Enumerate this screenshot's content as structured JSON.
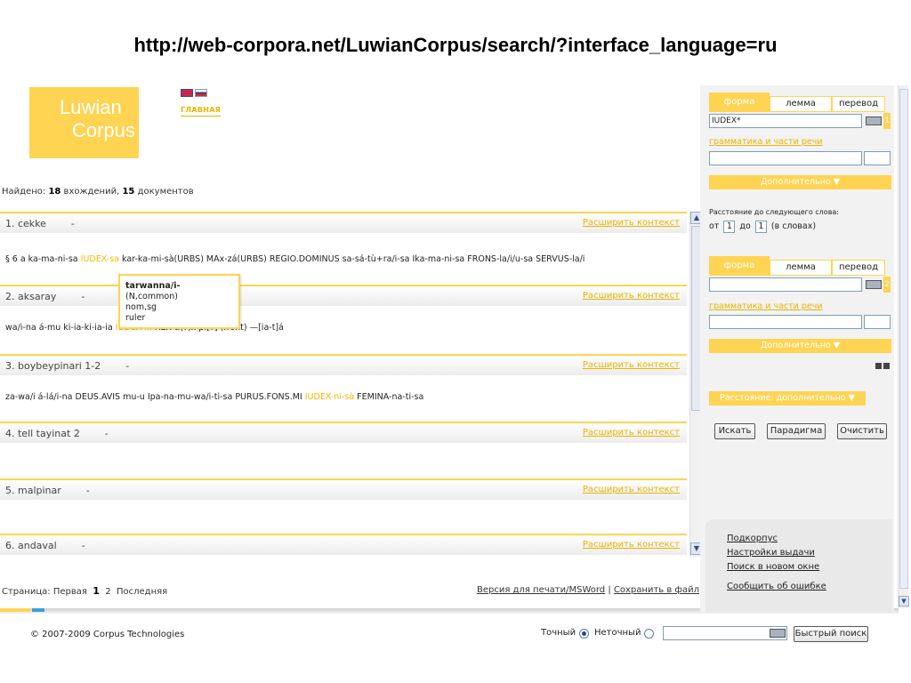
{
  "slide_title": "http://web-corpora.net/LuwianCorpus/search/?interface_language=ru",
  "logo": {
    "line1": "Luwian",
    "line2": "Corpus"
  },
  "header": {
    "home_link": "ГЛАВНАЯ",
    "flag_en": "english-flag-icon",
    "flag_ru": "russian-flag-icon"
  },
  "found": {
    "prefix": "Найдено:",
    "occurrences": "18",
    "occ_label": "вхождений,",
    "documents": "15",
    "doc_label": "документов"
  },
  "expand_label": "Расширить контекст",
  "results": [
    {
      "doc": "1. cekke        -",
      "pre": "§ 6 a ka-ma-ni-sa ",
      "hit": "IUDEX-sa",
      "post": " kar-ka-mi-sà(URBS) MAx-zá(URBS) REGIO.DOMINUS sa-sá-tù+ra/i-sa Ika-ma-ni-sa FRONS-la/i/u-sa SERVUS-la/i"
    },
    {
      "doc": "2. aksaray        -",
      "pre": "wa/i-na á-mu ki-ia-ki-ia-ia ",
      "hit": "IUDEX-ni",
      "post": " REX-ti(?)x pi[?] (front) —[ia-t]á"
    },
    {
      "doc": "3. boybeypinari 1-2        -",
      "pre": "za-wa/i á-lá/i-na DEUS.AVIS mu-u Ipa-na-mu-wa/i-ti-sa PURUS.FONS.MI ",
      "hit": "IUDEX-ni-sà",
      "post": " FEMINA-na-ti-sa"
    },
    {
      "doc": "4. tell tayinat 2        -",
      "pre": "",
      "hit": "",
      "post": ""
    },
    {
      "doc": "5. malpinar        -",
      "pre": "",
      "hit": "",
      "post": ""
    },
    {
      "doc": "6. andaval        -",
      "pre": "",
      "hit": "",
      "post": ""
    }
  ],
  "tooltip": {
    "lemma": "tarwanna/i-",
    "gram_info": "(N,common)",
    "form": "nom,sg",
    "gloss": "ruler"
  },
  "pager": {
    "label": "Страница:",
    "first": "Первая",
    "current": "1",
    "next": "2",
    "last": "Последняя"
  },
  "print_links": {
    "print": "Версия для печати/MSWord",
    "sep": "|",
    "save": "Сохранить в файл"
  },
  "footer": {
    "copyright": "© 2007-2009 Corpus Technologies",
    "exact": "Точный",
    "inexact": "Неточный",
    "quick_search": "Быстрый поиск",
    "quick_value": ""
  },
  "sidebar": {
    "tabs": {
      "form": "форма",
      "lemma": "лемма",
      "translation": "перевод"
    },
    "word1": {
      "form_value": "IUDEX*",
      "index": "1",
      "gram_link": "грамматика и части речи",
      "advanced": "Дополнительно ▼"
    },
    "distance": {
      "title": "Расстояние до следующего слова:",
      "from_label": "от",
      "from_value": "1",
      "to_label": "до",
      "to_value": "1",
      "unit": "(в словах)"
    },
    "word2": {
      "form_value": "",
      "index": "2",
      "gram_link": "грамматика и части речи",
      "advanced": "Дополнительно ▼"
    },
    "distance_advanced": "Расстояние: дополнительно ▼",
    "buttons": {
      "search": "Искать",
      "paradigm": "Парадигма",
      "clear": "Очистить"
    },
    "links": {
      "subcorpus": "Подкорпус",
      "output_settings": "Настройки выдачи",
      "new_window": "Поиск в новом окне",
      "report_error": "Сообщить об ошибке"
    }
  },
  "colors": {
    "accent": "#ffd452",
    "link": "#e8b400",
    "highlight": "#f2b800"
  }
}
